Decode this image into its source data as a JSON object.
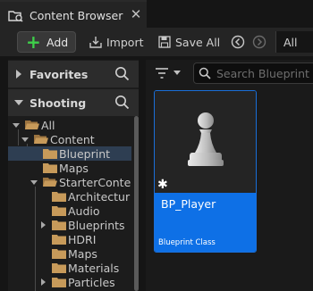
{
  "tab": {
    "title": "Content Browser",
    "close": "✕"
  },
  "toolbar": {
    "add_label": "Add",
    "import_label": "Import",
    "save_all_label": "Save All",
    "path_root": "All"
  },
  "sidebar": {
    "favorites_label": "Favorites",
    "project_label": "Shooting",
    "tree": [
      {
        "label": "All"
      },
      {
        "label": "Content"
      },
      {
        "label": "Blueprint"
      },
      {
        "label": "Maps"
      },
      {
        "label": "StarterConte"
      },
      {
        "label": "Architectur"
      },
      {
        "label": "Audio"
      },
      {
        "label": "Blueprints"
      },
      {
        "label": "HDRI"
      },
      {
        "label": "Maps"
      },
      {
        "label": "Materials"
      },
      {
        "label": "Particles"
      }
    ]
  },
  "search": {
    "placeholder": "Search Blueprint"
  },
  "assets": [
    {
      "name": "BP_Player",
      "type": "Blueprint Class",
      "modified_marker": "✱"
    }
  ],
  "colors": {
    "accent": "#0e70e6",
    "add_green": "#3ed04a",
    "folder": "#c79a5a",
    "selection": "#2e3e52"
  }
}
